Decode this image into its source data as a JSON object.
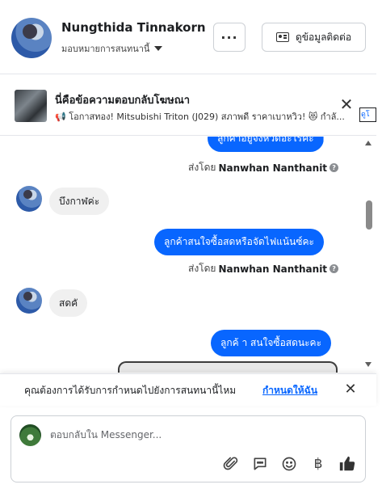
{
  "header": {
    "contact_name": "Nungthida Tinnakorn",
    "assign_label": "มอบหมายการสนทนานี้",
    "more_label": "···",
    "contact_info_label": "ดูข้อมูลติดต่อ"
  },
  "ad": {
    "title": "นี่คือข้อความตอบกลับโฆษณา",
    "subtitle": "📢 โอกาสทอง! Mitsubishi Triton (J029) สภาพดี ราคาเบาหวิว! 😻 กำลั...",
    "close_label": "✕",
    "edge_link": "ดูโ"
  },
  "messages": [
    {
      "direction": "out",
      "text": "ลูกค้าอยู่จังหวัดอะไรคะ"
    },
    {
      "direction": "meta",
      "prefix": "ส่งโดย",
      "sender": "Nanwhan Nanthanit"
    },
    {
      "direction": "in",
      "text": "บึงกาฬค่ะ"
    },
    {
      "direction": "out",
      "text": "ลูกค้าสนใจซื้อสดหรือจัดไฟแน้นซ์คะ"
    },
    {
      "direction": "meta",
      "prefix": "ส่งโดย",
      "sender": "Nanwhan Nanthanit"
    },
    {
      "direction": "in",
      "text": "สดคั"
    },
    {
      "direction": "out",
      "text": "ลูกค้ า สนใจซื้อสดนะคะ"
    }
  ],
  "notify": {
    "text": "คุณต้องการได้รับการกำหนดไปยังการสนทนานี้ไหม",
    "link": "กำหนดให้ฉัน",
    "close_label": "✕"
  },
  "composer": {
    "placeholder": "ตอบกลับใน Messenger...",
    "value": ""
  },
  "icons": {
    "attach": "paperclip-icon",
    "saved_reply": "chat-bubble-icon",
    "emoji": "smiley-icon",
    "payment": "baht-icon",
    "like": "thumbs-up-icon"
  },
  "colors": {
    "accent": "#0866ff",
    "bubble_in": "#f0f0f0"
  }
}
